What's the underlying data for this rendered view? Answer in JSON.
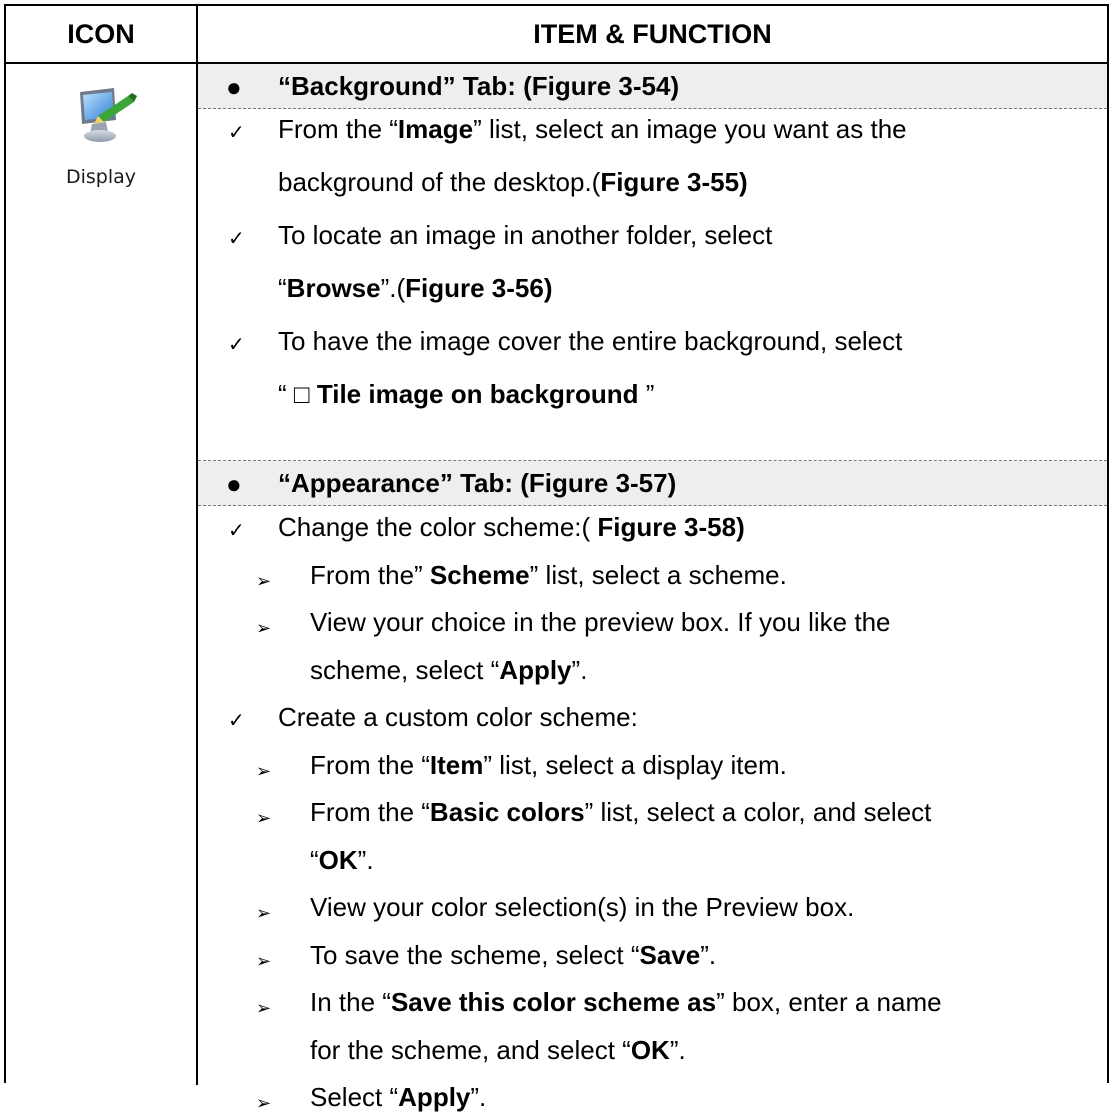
{
  "header": {
    "icon_col": "ICON",
    "func_col": "ITEM & FUNCTION"
  },
  "icon": {
    "name": "display-icon",
    "label": "Display"
  },
  "background_tab": {
    "bullet": "●",
    "title": "“Background” Tab: (Figure 3-54)",
    "items": [
      {
        "mark": "✓",
        "parts": [
          [
            "From the “",
            0
          ],
          [
            "Image",
            1
          ],
          [
            "” list, select an image you want as the",
            0
          ]
        ]
      },
      {
        "mark": "",
        "parts": [
          [
            "background of the desktop.(",
            0
          ],
          [
            "Figure 3-55)",
            1
          ]
        ]
      },
      {
        "mark": "✓",
        "parts": [
          [
            "To locate an image in another folder, select",
            0
          ]
        ]
      },
      {
        "mark": "",
        "parts": [
          [
            "“",
            0
          ],
          [
            "Browse",
            1
          ],
          [
            "”.(",
            0
          ],
          [
            "Figure 3-56)",
            1
          ]
        ]
      },
      {
        "mark": "✓",
        "parts": [
          [
            "To have the image cover the entire background, select",
            0
          ]
        ]
      },
      {
        "mark": "",
        "parts": [
          [
            "“ □ ",
            0
          ],
          [
            "Tile image on background",
            1
          ],
          [
            " ”",
            0
          ]
        ]
      }
    ]
  },
  "appearance_tab": {
    "bullet": "●",
    "title": "“Appearance” Tab: (Figure 3-57)",
    "items": [
      {
        "level": 1,
        "mark": "✓",
        "parts": [
          [
            "Change the color scheme:( ",
            0
          ],
          [
            "Figure 3-58)",
            1
          ]
        ]
      },
      {
        "level": 2,
        "mark": "➢",
        "parts": [
          [
            "From the” ",
            0
          ],
          [
            "Scheme",
            1
          ],
          [
            "” list, select a scheme.",
            0
          ]
        ]
      },
      {
        "level": 2,
        "mark": "➢",
        "parts": [
          [
            "View your choice in the preview box. If you like the",
            0
          ]
        ]
      },
      {
        "level": 2,
        "mark": "",
        "parts": [
          [
            "scheme, select “",
            0
          ],
          [
            "Apply",
            1
          ],
          [
            "”.",
            0
          ]
        ]
      },
      {
        "level": 1,
        "mark": "✓",
        "parts": [
          [
            "Create a custom color scheme:",
            0
          ]
        ]
      },
      {
        "level": 2,
        "mark": "➢",
        "parts": [
          [
            "From the “",
            0
          ],
          [
            "Item",
            1
          ],
          [
            "” list, select a display item.",
            0
          ]
        ]
      },
      {
        "level": 2,
        "mark": "➢",
        "parts": [
          [
            "From the “",
            0
          ],
          [
            "Basic colors",
            1
          ],
          [
            "” list, select a color, and select",
            0
          ]
        ]
      },
      {
        "level": 2,
        "mark": "",
        "parts": [
          [
            "“",
            0
          ],
          [
            "OK",
            1
          ],
          [
            "”.",
            0
          ]
        ]
      },
      {
        "level": 2,
        "mark": "➢",
        "parts": [
          [
            "View your color selection(s) in the Preview box.",
            0
          ]
        ]
      },
      {
        "level": 2,
        "mark": "➢",
        "parts": [
          [
            "To save the scheme, select “",
            0
          ],
          [
            "Save",
            1
          ],
          [
            "”.",
            0
          ]
        ]
      },
      {
        "level": 2,
        "mark": "➢",
        "parts": [
          [
            "In the “",
            0
          ],
          [
            "Save this color scheme as",
            1
          ],
          [
            "” box, enter a name",
            0
          ]
        ]
      },
      {
        "level": 2,
        "mark": "",
        "parts": [
          [
            "for the scheme, and select “",
            0
          ],
          [
            "OK",
            1
          ],
          [
            "”.",
            0
          ]
        ]
      },
      {
        "level": 2,
        "mark": "➢",
        "parts": [
          [
            "Select “",
            0
          ],
          [
            "Apply",
            1
          ],
          [
            "”.",
            0
          ]
        ]
      }
    ]
  }
}
